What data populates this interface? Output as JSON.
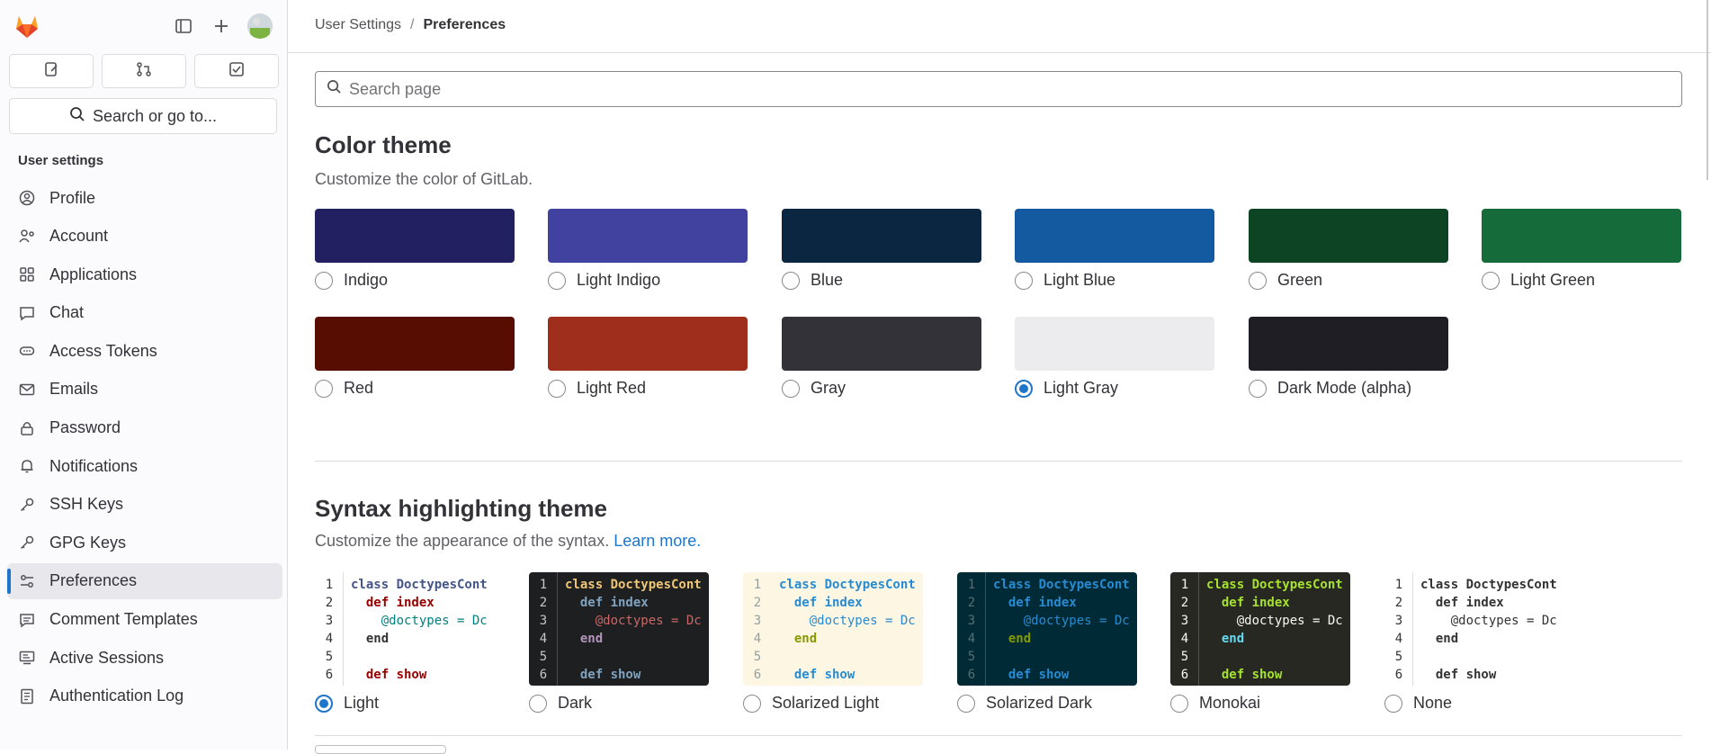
{
  "sidebar": {
    "heading": "User settings",
    "search_label": "Search or go to...",
    "items": [
      {
        "label": "Profile",
        "icon": "profile-icon"
      },
      {
        "label": "Account",
        "icon": "account-icon"
      },
      {
        "label": "Applications",
        "icon": "applications-icon"
      },
      {
        "label": "Chat",
        "icon": "chat-icon"
      },
      {
        "label": "Access Tokens",
        "icon": "token-icon"
      },
      {
        "label": "Emails",
        "icon": "email-icon"
      },
      {
        "label": "Password",
        "icon": "lock-icon"
      },
      {
        "label": "Notifications",
        "icon": "bell-icon"
      },
      {
        "label": "SSH Keys",
        "icon": "key-icon"
      },
      {
        "label": "GPG Keys",
        "icon": "key-icon"
      },
      {
        "label": "Preferences",
        "icon": "preferences-icon",
        "active": true
      },
      {
        "label": "Comment Templates",
        "icon": "comment-icon"
      },
      {
        "label": "Active Sessions",
        "icon": "monitor-icon"
      },
      {
        "label": "Authentication Log",
        "icon": "log-icon"
      }
    ]
  },
  "breadcrumbs": {
    "parent": "User Settings",
    "separator": "/",
    "current": "Preferences"
  },
  "search": {
    "placeholder": "Search page"
  },
  "color_theme": {
    "title": "Color theme",
    "description": "Customize the color of GitLab.",
    "themes": [
      {
        "label": "Indigo",
        "color": "#222061",
        "selected": false
      },
      {
        "label": "Light Indigo",
        "color": "#41419f",
        "selected": false
      },
      {
        "label": "Blue",
        "color": "#0b2640",
        "selected": false
      },
      {
        "label": "Light Blue",
        "color": "#145aa1",
        "selected": false
      },
      {
        "label": "Green",
        "color": "#0d4524",
        "selected": false
      },
      {
        "label": "Light Green",
        "color": "#156b39",
        "selected": false
      },
      {
        "label": "Red",
        "color": "#580d02",
        "selected": false
      },
      {
        "label": "Light Red",
        "color": "#a02e1c",
        "selected": false
      },
      {
        "label": "Gray",
        "color": "#333238",
        "selected": false
      },
      {
        "label": "Light Gray",
        "color": "#ececef",
        "selected": true
      },
      {
        "label": "Dark Mode (alpha)",
        "color": "#1f1e24",
        "selected": false
      }
    ]
  },
  "syntax_theme": {
    "title": "Syntax highlighting theme",
    "description": "Customize the appearance of the syntax.",
    "learn_more": "Learn more.",
    "code_lines": [
      "class DoctypesCont",
      "  def index",
      "    @doctypes = Dc",
      "  end",
      "",
      "  def show"
    ],
    "line_numbers": [
      "1",
      "2",
      "3",
      "4",
      "5",
      "6"
    ],
    "themes": [
      {
        "label": "Light",
        "selected": true,
        "bg": "#ffffff",
        "fg": "#333333",
        "num": "#333333",
        "kw": "#333333",
        "cls": "#445588",
        "fn": "#990000",
        "var": "#008080"
      },
      {
        "label": "Dark",
        "selected": false,
        "bg": "#1d1f21",
        "fg": "#c5c8c6",
        "num": "#c5c8c6",
        "kw": "#b294bb",
        "cls": "#f0c674",
        "fn": "#81a2be",
        "var": "#cc6666"
      },
      {
        "label": "Solarized Light",
        "selected": false,
        "bg": "#fdf6e3",
        "fg": "#657b83",
        "num": "#93a1a1",
        "kw": "#859900",
        "cls": "#268bd2",
        "fn": "#268bd2",
        "var": "#268bd2"
      },
      {
        "label": "Solarized Dark",
        "selected": false,
        "bg": "#002b36",
        "fg": "#93a1a1",
        "num": "#586e75",
        "kw": "#859900",
        "cls": "#268bd2",
        "fn": "#268bd2",
        "var": "#268bd2"
      },
      {
        "label": "Monokai",
        "selected": false,
        "bg": "#272822",
        "fg": "#f8f8f2",
        "num": "#f8f8f2",
        "kw": "#66d9ef",
        "cls": "#a6e22e",
        "fn": "#a6e22e",
        "var": "#f8f8f2"
      },
      {
        "label": "None",
        "selected": false,
        "bg": "#ffffff",
        "fg": "#333333",
        "num": "#333333",
        "kw": "#333333",
        "cls": "#333333",
        "fn": "#333333",
        "var": "#333333"
      }
    ]
  }
}
